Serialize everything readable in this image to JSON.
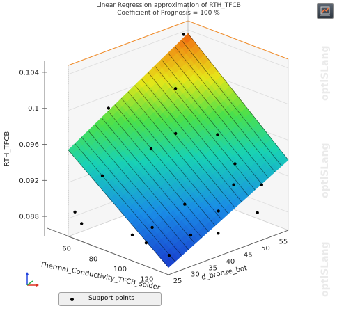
{
  "header": {
    "title": "Linear Regression  approximation of RTH_TFCB",
    "subtitle": "Coefficient of Prognosis = 100 %"
  },
  "watermark": {
    "text": "optiSLang"
  },
  "legend": {
    "support_points_label": "Support points"
  },
  "colors": {
    "bounding_box": "#f28c28",
    "surface_low": "#1a2cc8",
    "surface_high": "#e8140a",
    "points": "#000000"
  },
  "chart_data": {
    "type": "surface3d",
    "title": "Linear Regression  approximation of RTH_TFCB",
    "subtitle": "Coefficient of Prognosis = 100 %",
    "xlabel": "Thermal_Conductivity_TFCB_solder",
    "ylabel": "d_bronze_bot",
    "zlabel": "RTH_TFCB",
    "xlim": [
      55,
      130
    ],
    "ylim": [
      24,
      58
    ],
    "zlim": [
      0.086,
      0.105
    ],
    "x_ticks": [
      "60",
      "80",
      "100",
      "120"
    ],
    "y_ticks": [
      "25",
      "30",
      "35",
      "40",
      "45",
      "50",
      "55"
    ],
    "z_ticks": [
      "0.088",
      "0.092",
      "0.096",
      "0.1",
      "0.104"
    ],
    "surface_corners": [
      {
        "x": 55,
        "y": 24,
        "z": 0.0956
      },
      {
        "x": 55,
        "y": 58,
        "z": 0.1036
      },
      {
        "x": 130,
        "y": 24,
        "z": 0.0868
      },
      {
        "x": 130,
        "y": 58,
        "z": 0.0938
      }
    ],
    "points": [
      {
        "x": 57,
        "y": 56,
        "z": 0.1039
      },
      {
        "x": 60,
        "y": 24,
        "z": 0.089
      },
      {
        "x": 64,
        "y": 32,
        "z": 0.0996
      },
      {
        "x": 65,
        "y": 24,
        "z": 0.088
      },
      {
        "x": 70,
        "y": 28,
        "z": 0.093
      },
      {
        "x": 72,
        "y": 48,
        "z": 0.0999
      },
      {
        "x": 80,
        "y": 45,
        "z": 0.0958
      },
      {
        "x": 85,
        "y": 55,
        "z": 0.0945
      },
      {
        "x": 88,
        "y": 35,
        "z": 0.096
      },
      {
        "x": 95,
        "y": 27,
        "z": 0.088
      },
      {
        "x": 98,
        "y": 55,
        "z": 0.092
      },
      {
        "x": 100,
        "y": 40,
        "z": 0.0898
      },
      {
        "x": 102,
        "y": 30,
        "z": 0.0888
      },
      {
        "x": 105,
        "y": 52,
        "z": 0.0905
      },
      {
        "x": 108,
        "y": 26,
        "z": 0.088
      },
      {
        "x": 112,
        "y": 45,
        "z": 0.089
      },
      {
        "x": 115,
        "y": 36,
        "z": 0.0878
      },
      {
        "x": 118,
        "y": 55,
        "z": 0.0908
      },
      {
        "x": 120,
        "y": 28,
        "z": 0.087
      },
      {
        "x": 125,
        "y": 40,
        "z": 0.088
      },
      {
        "x": 128,
        "y": 50,
        "z": 0.089
      }
    ]
  }
}
